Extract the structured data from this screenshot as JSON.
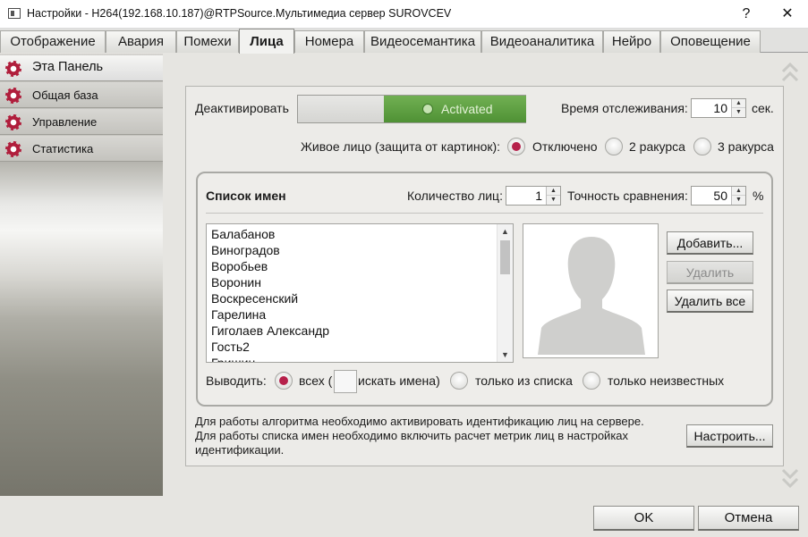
{
  "window": {
    "title": "Настройки - H264(192.168.10.187)@RTPSource.Мультимедиа сервер SUROVCEV",
    "help": "?",
    "close": "✕"
  },
  "tabs": [
    "Отображение",
    "Авария",
    "Помехи",
    "Лица",
    "Номера",
    "Видеосемантика",
    "Видеоаналитика",
    "Нейро",
    "Оповещение"
  ],
  "active_tab": "Лица",
  "sidebar": {
    "items": [
      {
        "label": "Эта Панель",
        "icon": "gear-icon",
        "active": true
      },
      {
        "label": "Общая база",
        "icon": "gear-icon"
      },
      {
        "label": "Управление",
        "icon": "gear-icon"
      },
      {
        "label": "Статистика",
        "icon": "gear-icon"
      }
    ]
  },
  "main": {
    "deactivate_label": "Деактивировать",
    "toggle_state": "Activated",
    "tracking_time_label": "Время отслеживания:",
    "tracking_time_value": "10",
    "tracking_time_unit": "сек.",
    "live_face_label": "Живое лицо (защита от картинок):",
    "live_face_options": [
      "Отключено",
      "2 ракурса",
      "3 ракурса"
    ],
    "live_face_selected": "Отключено",
    "name_list": {
      "title": "Список имен",
      "face_count_label": "Количество лиц:",
      "face_count_value": "1",
      "accuracy_label": "Точность сравнения:",
      "accuracy_value": "50",
      "accuracy_unit": "%",
      "names": [
        "Балабанов",
        "Виноградов",
        "Воробьев",
        "Воронин",
        "Воскресенский",
        "Гарелина",
        "Гиголаев Александр",
        "Гость2",
        "Гришин"
      ],
      "buttons": {
        "add": "Добавить...",
        "delete": "Удалить",
        "delete_all": "Удалить все"
      },
      "output_label": "Выводить:",
      "output_all_prefix": "всех (",
      "output_search_suffix": "искать имена)",
      "output_options": [
        "только из списка",
        "только неизвестных"
      ],
      "output_selected": "всех"
    },
    "info_lines": [
      "Для работы алгоритма необходимо активировать идентификацию лиц на сервере.",
      "Для работы списка имен необходимо включить расчет метрик лиц в настройках идентификации."
    ],
    "configure_button": "Настроить..."
  },
  "footer": {
    "ok": "OK",
    "cancel": "Отмена"
  },
  "colors": {
    "accent": "#b6204a",
    "toggle_on": "#5c9e41"
  }
}
